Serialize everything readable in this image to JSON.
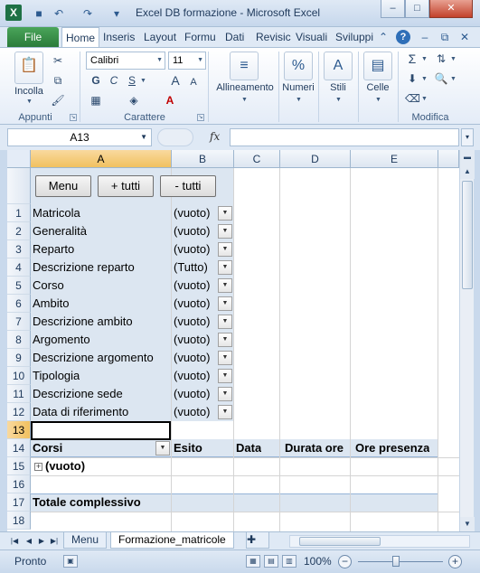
{
  "window": {
    "title": "Excel DB formazione  -  Microsoft Excel",
    "app_icon": "X",
    "minimize": "–",
    "maximize": "□",
    "close": "✕"
  },
  "quick_access": {
    "save": "💾",
    "undo": "↶",
    "redo": "↷",
    "customize": "▾"
  },
  "ribbon": {
    "file_tab": "File",
    "tabs": [
      "Home",
      "Inseris",
      "Layout",
      "Formu",
      "Dati",
      "Revisic",
      "Visuali",
      "Sviluppi"
    ],
    "active_tab": "Home",
    "clipboard": {
      "label": "Appunti",
      "paste": "Incolla"
    },
    "font": {
      "label": "Carattere",
      "name": "Calibri",
      "size": "11",
      "bold": "G",
      "italic": "C",
      "underline": "S"
    },
    "alignment": {
      "label": "Allineamento"
    },
    "number": {
      "label": "Numeri",
      "symbol": "%"
    },
    "styles": {
      "label": "Stili"
    },
    "cells": {
      "label": "Celle"
    },
    "editing": {
      "label": "Modifica",
      "sum": "Σ"
    }
  },
  "formula_bar": {
    "name_box": "A13",
    "fx": "fx",
    "formula": ""
  },
  "grid": {
    "columns": [
      "A",
      "B",
      "C",
      "D",
      "E"
    ],
    "selected_column": "A",
    "rows": [
      "",
      "1",
      "2",
      "3",
      "4",
      "5",
      "6",
      "7",
      "8",
      "9",
      "10",
      "11",
      "12",
      "13",
      "14",
      "15",
      "16",
      "17",
      "18"
    ],
    "selected_row": "13",
    "buttons": {
      "menu": "Menu",
      "all": "+ tutti",
      "none": "- tutti"
    },
    "filters": [
      {
        "field": "Matricola",
        "value": "(vuoto)"
      },
      {
        "field": "Generalità",
        "value": "(vuoto)"
      },
      {
        "field": "Reparto",
        "value": "(vuoto)"
      },
      {
        "field": "Descrizione reparto",
        "value": "(Tutto)"
      },
      {
        "field": "Corso",
        "value": "(vuoto)"
      },
      {
        "field": "Ambito",
        "value": "(vuoto)"
      },
      {
        "field": "Descrizione ambito",
        "value": "(vuoto)"
      },
      {
        "field": "Argomento",
        "value": "(vuoto)"
      },
      {
        "field": "Descrizione argomento",
        "value": "(vuoto)"
      },
      {
        "field": "Tipologia",
        "value": "(vuoto)"
      },
      {
        "field": "Descrizione sede",
        "value": "(vuoto)"
      },
      {
        "field": "Data di riferimento",
        "value": "(vuoto)"
      }
    ],
    "pivot_headers": [
      "Corsi",
      "Esito",
      "Data",
      "Durata ore",
      "Ore presenza"
    ],
    "pivot_row_item": "(vuoto)",
    "grand_total": "Totale complessivo"
  },
  "sheet_tabs": [
    "Menu",
    "Formazione_matricole"
  ],
  "active_sheet": "Formazione_matricole",
  "status": {
    "text": "Pronto",
    "zoom": "100%"
  }
}
